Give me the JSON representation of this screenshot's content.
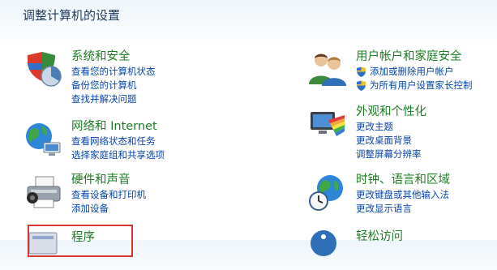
{
  "page": {
    "title": "调整计算机的设置"
  },
  "left_categories": [
    {
      "icon": "system-security-icon",
      "title": "系统和安全",
      "links": [
        {
          "text": "查看您的计算机状态",
          "shield": false
        },
        {
          "text": "备份您的计算机",
          "shield": false
        },
        {
          "text": "查找并解决问题",
          "shield": false
        }
      ]
    },
    {
      "icon": "network-internet-icon",
      "title": "网络和 Internet",
      "links": [
        {
          "text": "查看网络状态和任务",
          "shield": false
        },
        {
          "text": "选择家庭组和共享选项",
          "shield": false
        }
      ]
    },
    {
      "icon": "hardware-sound-icon",
      "title": "硬件和声音",
      "links": [
        {
          "text": "查看设备和打印机",
          "shield": false
        },
        {
          "text": "添加设备",
          "shield": false
        }
      ]
    },
    {
      "icon": "programs-icon",
      "title": "程序",
      "links": []
    }
  ],
  "right_categories": [
    {
      "icon": "user-accounts-icon",
      "title": "用户帐户和家庭安全",
      "links": [
        {
          "text": "添加或删除用户帐户",
          "shield": true
        },
        {
          "text": "为所有用户设置家长控制",
          "shield": true
        }
      ]
    },
    {
      "icon": "appearance-icon",
      "title": "外观和个性化",
      "links": [
        {
          "text": "更改主题",
          "shield": false
        },
        {
          "text": "更改桌面背景",
          "shield": false
        },
        {
          "text": "调整屏幕分辨率",
          "shield": false
        }
      ]
    },
    {
      "icon": "clock-language-region-icon",
      "title": "时钟、语言和区域",
      "links": [
        {
          "text": "更改键盘或其他输入法",
          "shield": false
        },
        {
          "text": "更改显示语言",
          "shield": false
        }
      ]
    },
    {
      "icon": "ease-of-access-icon",
      "title": "轻松访问",
      "links": []
    }
  ],
  "colors": {
    "category_title": "#1e7e24",
    "link": "#0645ad",
    "highlight_border": "#d9352e"
  }
}
